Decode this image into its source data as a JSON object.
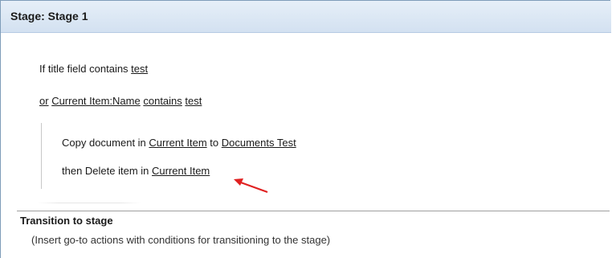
{
  "stage": {
    "title": "Stage: Stage 1"
  },
  "conditions": {
    "line1": {
      "prefix": "If title field contains ",
      "value": "test"
    },
    "line2": {
      "connector": "or",
      "field": "Current Item:Name",
      "operator": "contains",
      "value": "test"
    }
  },
  "actions": {
    "copy": {
      "prefix": "Copy document in ",
      "source": "Current Item",
      "middle": " to ",
      "destination": "Documents Test"
    },
    "delete": {
      "prefix": "then Delete item in ",
      "target": "Current Item"
    }
  },
  "transition": {
    "title": "Transition to stage",
    "hint": "(Insert go-to actions with conditions for transitioning to the stage)"
  },
  "colors": {
    "header_bg": "#d3e1f1",
    "arrow": "#e02020"
  }
}
